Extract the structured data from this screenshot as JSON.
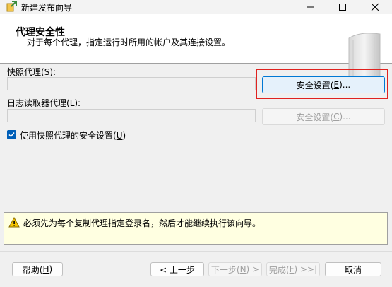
{
  "window": {
    "title": "新建发布向导",
    "minimize_icon": "minimize-icon",
    "maximize_icon": "maximize-icon",
    "close_icon": "close-icon"
  },
  "header": {
    "title": "代理安全性",
    "subtitle": "对于每个代理，指定运行时所用的帐户及其连接设置。"
  },
  "snapshot_agent": {
    "label": "快照代理(",
    "accesskey": "S",
    "label_end": "):",
    "value": "",
    "button_label_pre": "安全设置(",
    "button_accesskey": "E",
    "button_label_post": ")..."
  },
  "log_reader_agent": {
    "label": "日志读取器代理(",
    "accesskey": "L",
    "label_end": "):",
    "value": "",
    "button_label_pre": "安全设置(",
    "button_accesskey": "C",
    "button_label_post": ")..."
  },
  "use_snapshot_security": {
    "checked": true,
    "label_pre": "使用快照代理的安全设置(",
    "accesskey": "U",
    "label_post": ")"
  },
  "warning": {
    "icon": "warning-icon",
    "text": "必须先为每个复制代理指定登录名，然后才能继续执行该向导。"
  },
  "footer": {
    "help_pre": "帮助(",
    "help_key": "H",
    "help_post": ")",
    "back": "< 上一步",
    "next_pre": "下一步(",
    "next_key": "N",
    "next_post": ") >",
    "finish_pre": "完成(",
    "finish_key": "F",
    "finish_post": ") >>|",
    "cancel": "取消"
  },
  "colors": {
    "accent": "#0078d4",
    "highlight": "#e0221f",
    "warning_bg": "#ffffe1"
  }
}
